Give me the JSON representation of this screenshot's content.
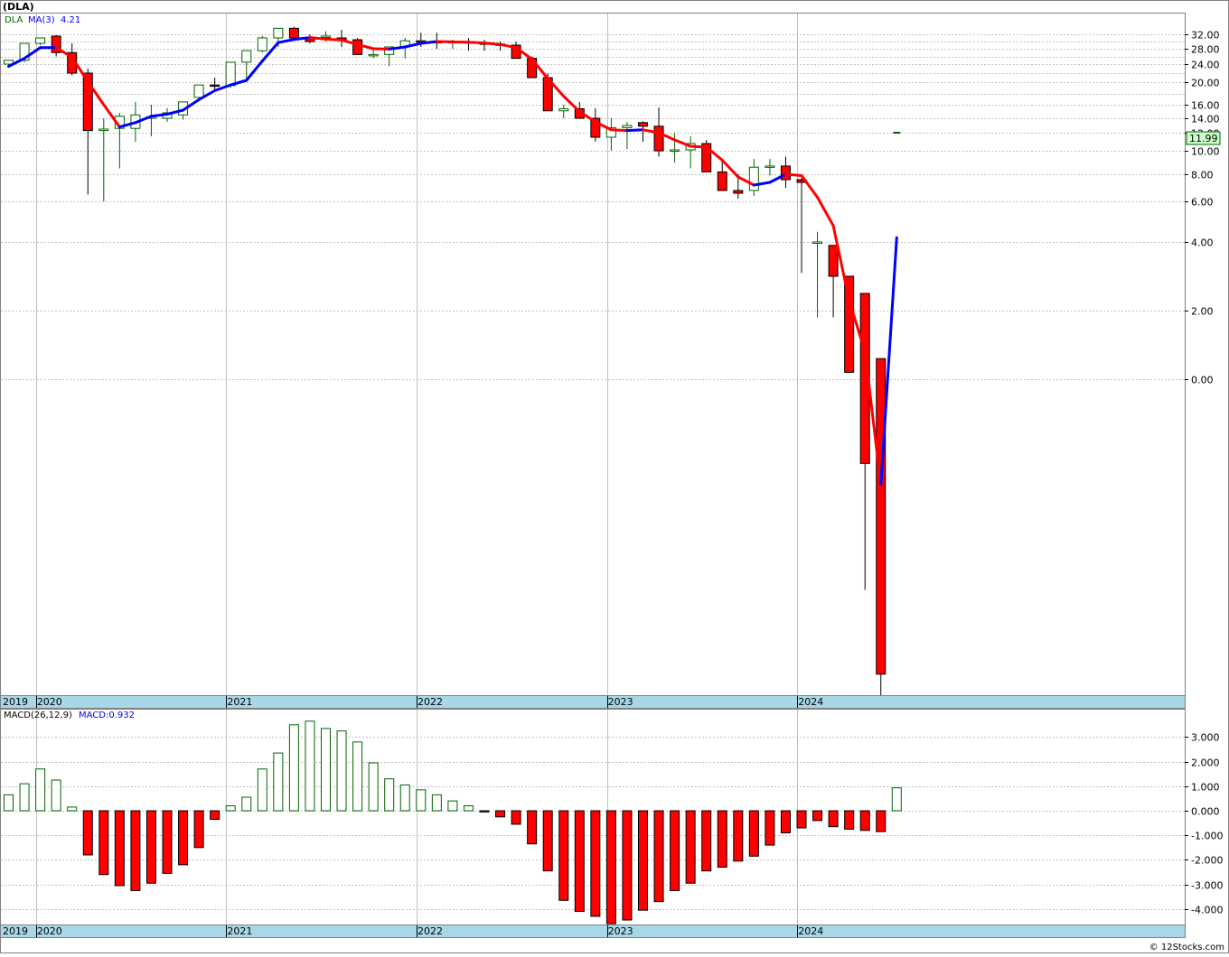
{
  "header": {
    "ticker_title": "(DLA)",
    "legend_symbol": "DLA",
    "legend_ma_label": "MA(3)",
    "legend_ma_value": "4.21"
  },
  "price_panel": {
    "last_price_badge": "11.99",
    "scale": "custom compressed log-like",
    "y_ticks": [
      "32.00",
      "28.00",
      "24.00",
      "20.00",
      "16.00",
      "14.00",
      "12.00",
      "10.00",
      "8.00",
      "6.00",
      "4.00",
      "2.00",
      "0.00"
    ]
  },
  "macd_panel": {
    "label": "MACD(26,12,9)",
    "value_label": "MACD:0.932",
    "y_ticks": [
      "3.000",
      "2.000",
      "1.000",
      "0.000",
      "-1.000",
      "-2.000",
      "-3.000",
      "-4.000"
    ]
  },
  "x_axis": {
    "year_labels": [
      "2019",
      "2020",
      "2021",
      "2022",
      "2023",
      "2024"
    ]
  },
  "credit": "© 12Stocks.com",
  "colors": {
    "up_candle_fill": "#ffffff",
    "up_candle_stroke": "#006400",
    "down_candle_fill": "#ff0000",
    "ma_up": "#0000ff",
    "ma_down": "#ff0000",
    "grid": "#c0c0c0",
    "axis_band": "#a8d8e8",
    "badge_fill": "#ccffcc"
  },
  "chart_data": {
    "type": "candlestick",
    "title": "(DLA)",
    "frequency": "monthly",
    "series": [
      {
        "name": "DLA",
        "x": [
          "2019-11",
          "2019-12",
          "2020-01",
          "2020-02",
          "2020-03",
          "2020-04",
          "2020-05",
          "2020-06",
          "2020-07",
          "2020-08",
          "2020-09",
          "2020-10",
          "2020-11",
          "2020-12",
          "2021-01",
          "2021-02",
          "2021-03",
          "2021-04",
          "2021-05",
          "2021-06",
          "2021-07",
          "2021-08",
          "2021-09",
          "2021-10",
          "2021-11",
          "2021-12",
          "2022-01",
          "2022-02",
          "2022-03",
          "2022-04",
          "2022-05",
          "2022-06",
          "2022-07",
          "2022-08",
          "2022-09",
          "2022-10",
          "2022-11",
          "2022-12",
          "2023-01",
          "2023-02",
          "2023-03",
          "2023-04",
          "2023-05",
          "2023-06",
          "2023-07",
          "2023-08",
          "2023-09",
          "2023-10",
          "2023-11",
          "2023-12",
          "2024-01",
          "2024-02",
          "2024-03",
          "2024-04",
          "2024-05",
          "2024-06",
          "2024-07"
        ],
        "open": [
          24.0,
          25.0,
          29.5,
          31.5,
          27.0,
          22.0,
          12.3,
          12.6,
          12.6,
          14.0,
          14.0,
          14.5,
          17.3,
          19.5,
          19.4,
          24.5,
          27.5,
          31.0,
          34.0,
          31.0,
          31.2,
          31.0,
          30.5,
          26.5,
          26.5,
          28.5,
          30.2,
          30.0,
          29.8,
          30.0,
          29.6,
          29.3,
          29.0,
          25.5,
          21.0,
          15.1,
          15.4,
          14.0,
          11.5,
          12.7,
          13.4,
          12.9,
          10.0,
          10.1,
          10.8,
          8.2,
          6.8,
          6.8,
          8.6,
          8.7,
          7.6,
          4.0,
          3.9,
          3.0,
          2.5,
          0.6,
          -0.8
        ],
        "high": [
          24.5,
          25.5,
          30.8,
          31.8,
          29.5,
          23.0,
          14.0,
          14.8,
          16.5,
          16.0,
          15.5,
          16.2,
          18.5,
          21.0,
          23.5,
          25.0,
          31.5,
          33.5,
          34.5,
          32.0,
          33.0,
          33.5,
          31.0,
          28.0,
          28.5,
          31.0,
          32.5,
          32.5,
          30.5,
          31.0,
          30.5,
          30.0,
          30.0,
          26.0,
          22.0,
          16.0,
          16.5,
          15.5,
          14.0,
          13.5,
          13.6,
          15.6,
          12.0,
          11.6,
          11.2,
          9.3,
          8.0,
          9.3,
          9.3,
          9.5,
          7.7,
          4.5,
          3.2,
          3.0,
          0.9,
          -0.6,
          12.0
        ],
        "low": [
          23.5,
          24.5,
          29.0,
          26.0,
          21.5,
          6.5,
          6.0,
          8.5,
          11.0,
          11.6,
          13.5,
          13.8,
          17.0,
          18.5,
          19.0,
          20.5,
          27.0,
          28.5,
          31.0,
          29.5,
          30.0,
          28.5,
          27.0,
          25.5,
          23.5,
          25.5,
          28.5,
          28.0,
          28.0,
          27.5,
          27.5,
          27.5,
          25.5,
          21.5,
          15.8,
          14.0,
          14.0,
          11.0,
          10.0,
          10.2,
          11.0,
          9.5,
          9.0,
          8.5,
          8.5,
          6.8,
          6.2,
          6.4,
          7.9,
          7.0,
          3.1,
          1.8,
          1.8,
          0.2,
          -2.0,
          -3.0,
          11.9
        ],
        "close": [
          25.0,
          29.5,
          31.0,
          27.0,
          22.0,
          12.3,
          12.5,
          14.3,
          14.5,
          14.2,
          14.8,
          16.5,
          19.5,
          19.4,
          24.5,
          27.5,
          31.0,
          34.0,
          31.0,
          30.0,
          31.5,
          30.5,
          26.5,
          26.5,
          28.5,
          30.2,
          30.0,
          29.8,
          30.0,
          29.6,
          29.3,
          29.0,
          25.5,
          21.0,
          15.1,
          15.4,
          14.0,
          11.5,
          12.7,
          13.0,
          12.9,
          10.0,
          10.1,
          10.8,
          8.2,
          6.8,
          6.6,
          8.6,
          8.7,
          7.6,
          7.4,
          4.0,
          3.0,
          0.2,
          -0.8,
          -2.8,
          12.0
        ]
      },
      {
        "name": "MA(3)",
        "x": [
          "2019-11",
          "2019-12",
          "2020-01",
          "2020-02",
          "2020-03",
          "2020-04",
          "2020-05",
          "2020-06",
          "2020-07",
          "2020-08",
          "2020-09",
          "2020-10",
          "2020-11",
          "2020-12",
          "2021-01",
          "2021-02",
          "2021-03",
          "2021-04",
          "2021-05",
          "2021-06",
          "2021-07",
          "2021-08",
          "2021-09",
          "2021-10",
          "2021-11",
          "2021-12",
          "2022-01",
          "2022-02",
          "2022-03",
          "2022-04",
          "2022-05",
          "2022-06",
          "2022-07",
          "2022-08",
          "2022-09",
          "2022-10",
          "2022-11",
          "2022-12",
          "2023-01",
          "2023-02",
          "2023-03",
          "2023-04",
          "2023-05",
          "2023-06",
          "2023-07",
          "2023-08",
          "2023-09",
          "2023-10",
          "2023-11",
          "2023-12",
          "2024-01",
          "2024-02",
          "2024-03",
          "2024-04",
          "2024-05",
          "2024-06",
          "2024-07"
        ],
        "values": [
          23.5,
          25.5,
          28.3,
          28.3,
          25.8,
          20.1,
          16.0,
          12.8,
          13.4,
          14.3,
          14.6,
          15.2,
          16.9,
          18.5,
          19.5,
          20.4,
          24.8,
          29.7,
          30.6,
          31.1,
          30.7,
          30.4,
          29.2,
          28.0,
          27.9,
          28.5,
          29.5,
          30.0,
          29.9,
          29.8,
          29.6,
          29.2,
          28.3,
          25.3,
          20.8,
          17.5,
          15.0,
          13.5,
          12.4,
          12.3,
          12.4,
          12.0,
          11.2,
          10.5,
          10.4,
          9.2,
          7.8,
          7.2,
          7.4,
          8.0,
          7.9,
          6.3,
          4.8,
          2.3,
          0.8,
          -1.0,
          4.21
        ]
      },
      {
        "name": "MACD(26,12,9)",
        "x": [
          "2019-11",
          "2019-12",
          "2020-01",
          "2020-02",
          "2020-03",
          "2020-04",
          "2020-05",
          "2020-06",
          "2020-07",
          "2020-08",
          "2020-09",
          "2020-10",
          "2020-11",
          "2020-12",
          "2021-01",
          "2021-02",
          "2021-03",
          "2021-04",
          "2021-05",
          "2021-06",
          "2021-07",
          "2021-08",
          "2021-09",
          "2021-10",
          "2021-11",
          "2021-12",
          "2022-01",
          "2022-02",
          "2022-03",
          "2022-04",
          "2022-05",
          "2022-06",
          "2022-07",
          "2022-08",
          "2022-09",
          "2022-10",
          "2022-11",
          "2022-12",
          "2023-01",
          "2023-02",
          "2023-03",
          "2023-04",
          "2023-05",
          "2023-06",
          "2023-07",
          "2023-08",
          "2023-09",
          "2023-10",
          "2023-11",
          "2023-12",
          "2024-01",
          "2024-02",
          "2024-03",
          "2024-04",
          "2024-05",
          "2024-06",
          "2024-07"
        ],
        "values": [
          0.65,
          1.1,
          1.7,
          1.25,
          0.15,
          -1.8,
          -2.6,
          -3.05,
          -3.25,
          -2.95,
          -2.55,
          -2.2,
          -1.5,
          -0.35,
          0.2,
          0.55,
          1.7,
          2.35,
          3.5,
          3.65,
          3.35,
          3.25,
          2.8,
          1.95,
          1.3,
          1.05,
          0.85,
          0.65,
          0.4,
          0.2,
          -0.05,
          -0.25,
          -0.55,
          -1.35,
          -2.45,
          -3.65,
          -4.1,
          -4.3,
          -4.6,
          -4.45,
          -4.05,
          -3.7,
          -3.25,
          -2.95,
          -2.45,
          -2.3,
          -2.05,
          -1.85,
          -1.4,
          -0.9,
          -0.7,
          -0.4,
          -0.65,
          -0.75,
          -0.8,
          -0.85,
          0.932
        ]
      }
    ]
  }
}
